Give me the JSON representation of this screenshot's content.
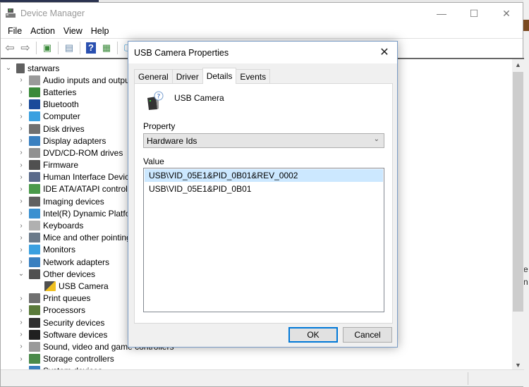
{
  "window": {
    "title": "Device Manager",
    "controls": {
      "minimize": "—",
      "maximize": "☐",
      "close": "✕"
    }
  },
  "menu": [
    "File",
    "Action",
    "View",
    "Help"
  ],
  "toolbar": [
    {
      "icon": "back-arrow-icon",
      "glyph": "⇦"
    },
    {
      "icon": "forward-arrow-icon",
      "glyph": "⇨"
    },
    {
      "icon": "show-hide-console-tree-icon",
      "glyph": "▣"
    },
    {
      "icon": "properties-icon",
      "glyph": "▤"
    },
    {
      "icon": "help-icon",
      "glyph": "?"
    },
    {
      "icon": "run-action-icon",
      "glyph": "▦"
    },
    {
      "icon": "scan-hardware-icon",
      "glyph": "🖵"
    }
  ],
  "tree": {
    "root": "starwars",
    "items": [
      {
        "label": "Audio inputs and outputs",
        "color": "#9a9a9a",
        "expanded": false
      },
      {
        "label": "Batteries",
        "color": "#3a8a3a",
        "expanded": false
      },
      {
        "label": "Bluetooth",
        "color": "#1a4a9a",
        "expanded": false
      },
      {
        "label": "Computer",
        "color": "#3aa0e0",
        "expanded": false
      },
      {
        "label": "Disk drives",
        "color": "#707070",
        "expanded": false
      },
      {
        "label": "Display adapters",
        "color": "#3a80c0",
        "expanded": false
      },
      {
        "label": "DVD/CD-ROM drives",
        "color": "#909090",
        "expanded": false
      },
      {
        "label": "Firmware",
        "color": "#505050",
        "expanded": false
      },
      {
        "label": "Human Interface Devices",
        "color": "#5a6a8a",
        "expanded": false
      },
      {
        "label": "IDE ATA/ATAPI controllers",
        "color": "#4a9a4a",
        "expanded": false
      },
      {
        "label": "Imaging devices",
        "color": "#606060",
        "expanded": false
      },
      {
        "label": "Intel(R) Dynamic Platform",
        "color": "#3a90d0",
        "expanded": false
      },
      {
        "label": "Keyboards",
        "color": "#b0b0b0",
        "expanded": false
      },
      {
        "label": "Mice and other pointing devices",
        "color": "#6a7a8a",
        "expanded": false
      },
      {
        "label": "Monitors",
        "color": "#3aa0e0",
        "expanded": false
      },
      {
        "label": "Network adapters",
        "color": "#3a80c0",
        "expanded": false
      },
      {
        "label": "Other devices",
        "color": "#505050",
        "expanded": true,
        "children": [
          {
            "label": "USB Camera",
            "warning": true
          }
        ]
      },
      {
        "label": "Print queues",
        "color": "#707070",
        "expanded": false
      },
      {
        "label": "Processors",
        "color": "#5a7a3a",
        "expanded": false
      },
      {
        "label": "Security devices",
        "color": "#303030",
        "expanded": false
      },
      {
        "label": "Software devices",
        "color": "#202020",
        "expanded": false
      },
      {
        "label": "Sound, video and game controllers",
        "color": "#9a9a9a",
        "expanded": false
      },
      {
        "label": "Storage controllers",
        "color": "#4a8a4a",
        "expanded": false
      },
      {
        "label": "System devices",
        "color": "#3a80c0",
        "expanded": false
      }
    ]
  },
  "dialog": {
    "title": "USB Camera Properties",
    "close": "✕",
    "tabs": [
      "General",
      "Driver",
      "Details",
      "Events"
    ],
    "active_tab": "Details",
    "device_name": "USB Camera",
    "property_label": "Property",
    "property_value": "Hardware Ids",
    "value_label": "Value",
    "values": [
      "USB\\VID_05E1&PID_0B01&REV_0002",
      "USB\\VID_05E1&PID_0B01"
    ],
    "selected_value_index": 0,
    "ok_label": "OK",
    "cancel_label": "Cancel"
  },
  "background_fragments": [
    "e",
    "n"
  ]
}
